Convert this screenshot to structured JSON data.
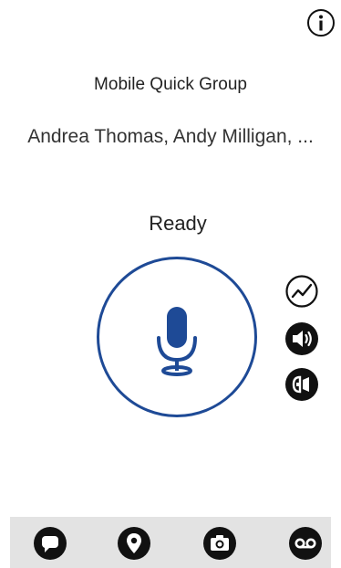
{
  "header": {
    "info_icon": "info-icon"
  },
  "group": {
    "title": "Mobile Quick Group",
    "members": "Andrea Thomas, Andy Milligan, ..."
  },
  "status": {
    "label": "Ready"
  },
  "ptt": {
    "icon": "microphone-icon",
    "accent_color": "#1e4a96"
  },
  "side_controls": [
    {
      "icon": "activity-icon"
    },
    {
      "icon": "speaker-icon"
    },
    {
      "icon": "earpiece-icon"
    }
  ],
  "bottom_bar": {
    "background_color": "#e3e3e3",
    "items": [
      {
        "icon": "message-icon"
      },
      {
        "icon": "location-icon"
      },
      {
        "icon": "camera-icon"
      },
      {
        "icon": "voicemail-icon"
      }
    ]
  }
}
